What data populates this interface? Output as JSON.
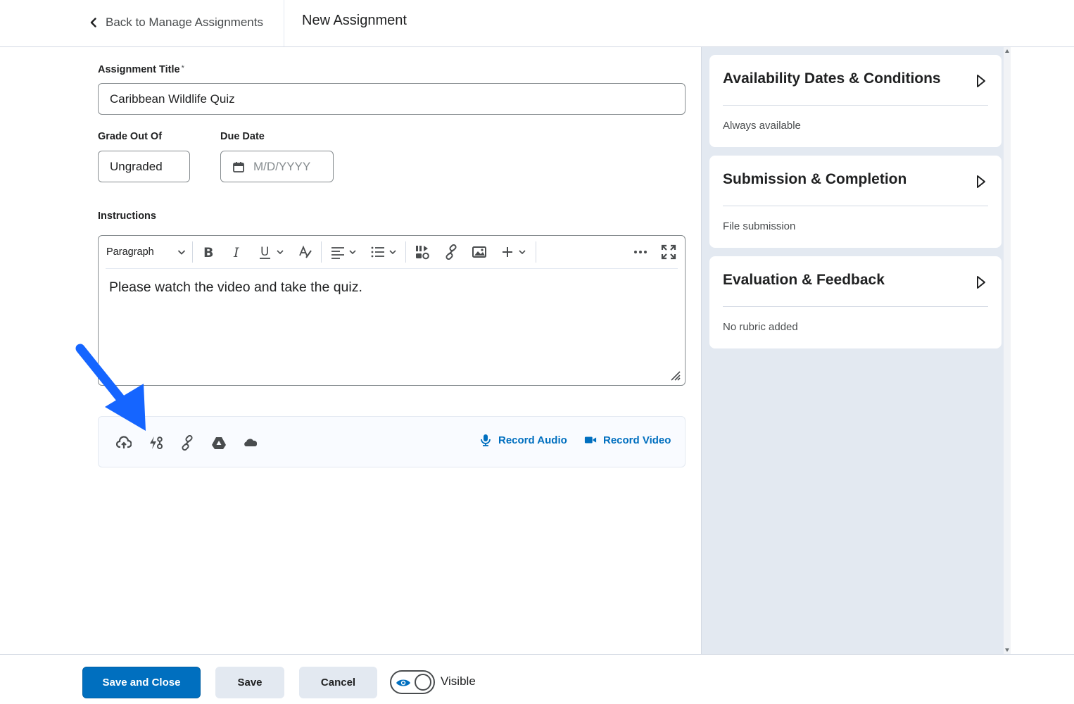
{
  "header": {
    "back_label": "Back to Manage Assignments",
    "page_title": "New Assignment"
  },
  "form": {
    "title_label": "Assignment Title",
    "title_required": "*",
    "title_value": "Caribbean Wildlife Quiz",
    "grade_label": "Grade Out Of",
    "grade_value": "Ungraded",
    "due_label": "Due Date",
    "due_placeholder": "M/D/YYYY",
    "instructions_label": "Instructions"
  },
  "editor": {
    "block_format": "Paragraph",
    "content": "Please watch the video and take the quiz."
  },
  "attachments": {
    "record_audio": "Record Audio",
    "record_video": "Record Video"
  },
  "panel": {
    "cards": [
      {
        "title": "Availability Dates & Conditions",
        "summary": "Always available"
      },
      {
        "title": "Submission & Completion",
        "summary": "File submission"
      },
      {
        "title": "Evaluation & Feedback",
        "summary": "No rubric added"
      }
    ]
  },
  "footer": {
    "save_close": "Save and Close",
    "save": "Save",
    "cancel": "Cancel",
    "visibility_label": "Visible"
  },
  "colors": {
    "primary": "#006fbf",
    "annotation_arrow": "#1565ff",
    "panel_bg": "#e3e9f1"
  }
}
